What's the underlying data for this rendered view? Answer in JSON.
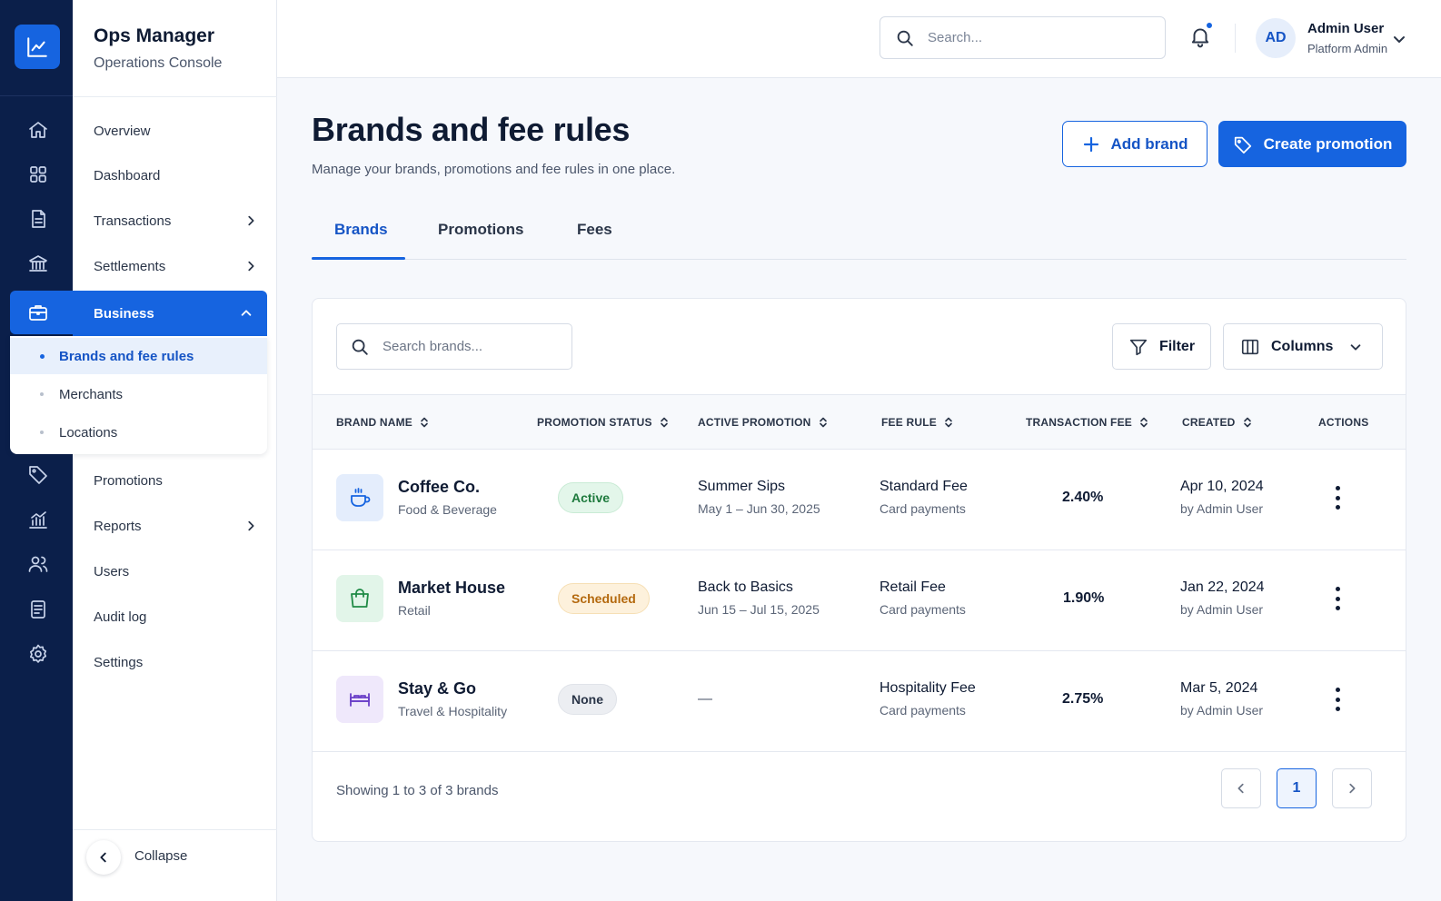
{
  "app": {
    "title": "Ops Manager",
    "subtitle": "Operations Console"
  },
  "rail_icons": [
    "trend-chart-icon",
    "home-icon",
    "grid-icon",
    "document-icon",
    "bank-icon",
    "briefcase-icon",
    "tag-icon",
    "bar-chart-icon",
    "users-icon",
    "log-icon",
    "gear-icon"
  ],
  "sidebar": {
    "items": [
      {
        "label": "Overview"
      },
      {
        "label": "Dashboard"
      },
      {
        "label": "Transactions"
      },
      {
        "label": "Settlements"
      },
      {
        "label": "Business"
      },
      {
        "label": "Promotions"
      },
      {
        "label": "Reports"
      },
      {
        "label": "Users"
      },
      {
        "label": "Audit log"
      },
      {
        "label": "Settings"
      }
    ],
    "business_sub": [
      {
        "label": "Brands and fee rules"
      },
      {
        "label": "Merchants"
      },
      {
        "label": "Locations"
      }
    ],
    "collapse_label": "Collapse"
  },
  "topbar": {
    "search_placeholder": "Search...",
    "avatar_initials": "AD",
    "user_name": "Admin User",
    "user_role": "Platform Admin"
  },
  "header": {
    "title": "Brands and fee rules",
    "subtitle": "Manage your brands, promotions and fee rules in one place.",
    "add_label": "Add brand",
    "create_label": "Create promotion"
  },
  "tabs": [
    {
      "label": "Brands"
    },
    {
      "label": "Promotions"
    },
    {
      "label": "Fees"
    }
  ],
  "table": {
    "search_placeholder": "Search brands...",
    "filter_label": "Filter",
    "columns_label": "Columns",
    "headers": [
      "BRAND NAME",
      "PROMOTION STATUS",
      "ACTIVE PROMOTION",
      "FEE RULE",
      "TRANSACTION FEE",
      "CREATED",
      "ACTIONS"
    ],
    "rows": [
      {
        "icon": "coffee-cup-icon",
        "name": "Coffee Co.",
        "category": "Food & Beverage",
        "status": "Active",
        "promo": "Summer Sips",
        "promo_dates": "May 1 – Jun 30, 2025",
        "fee_rule": "Standard Fee",
        "fee_rule_sub": "Card payments",
        "fee": "2.40%",
        "created": "Apr 10, 2024",
        "created_by": "by Admin User"
      },
      {
        "icon": "shopping-bag-icon",
        "name": "Market House",
        "category": "Retail",
        "status": "Scheduled",
        "promo": "Back to Basics",
        "promo_dates": "Jun 15 – Jul 15, 2025",
        "fee_rule": "Retail Fee",
        "fee_rule_sub": "Card payments",
        "fee": "1.90%",
        "created": "Jan 22, 2024",
        "created_by": "by Admin User"
      },
      {
        "icon": "bed-icon",
        "name": "Stay & Go",
        "category": "Travel & Hospitality",
        "status": "None",
        "promo": "—",
        "promo_dates": "",
        "fee_rule": "Hospitality Fee",
        "fee_rule_sub": "Card payments",
        "fee": "2.75%",
        "created": "Mar 5, 2024",
        "created_by": "by Admin User"
      }
    ],
    "footer_text": "Showing 1 to 3 of 3 brands",
    "current_page": "1"
  },
  "colors": {
    "accent": "#1664e0",
    "rail_bg": "#0b1f4a",
    "active_badge": "#e3f6ea",
    "scheduled_badge": "#fdf1dc",
    "none_badge": "#eceef2"
  }
}
